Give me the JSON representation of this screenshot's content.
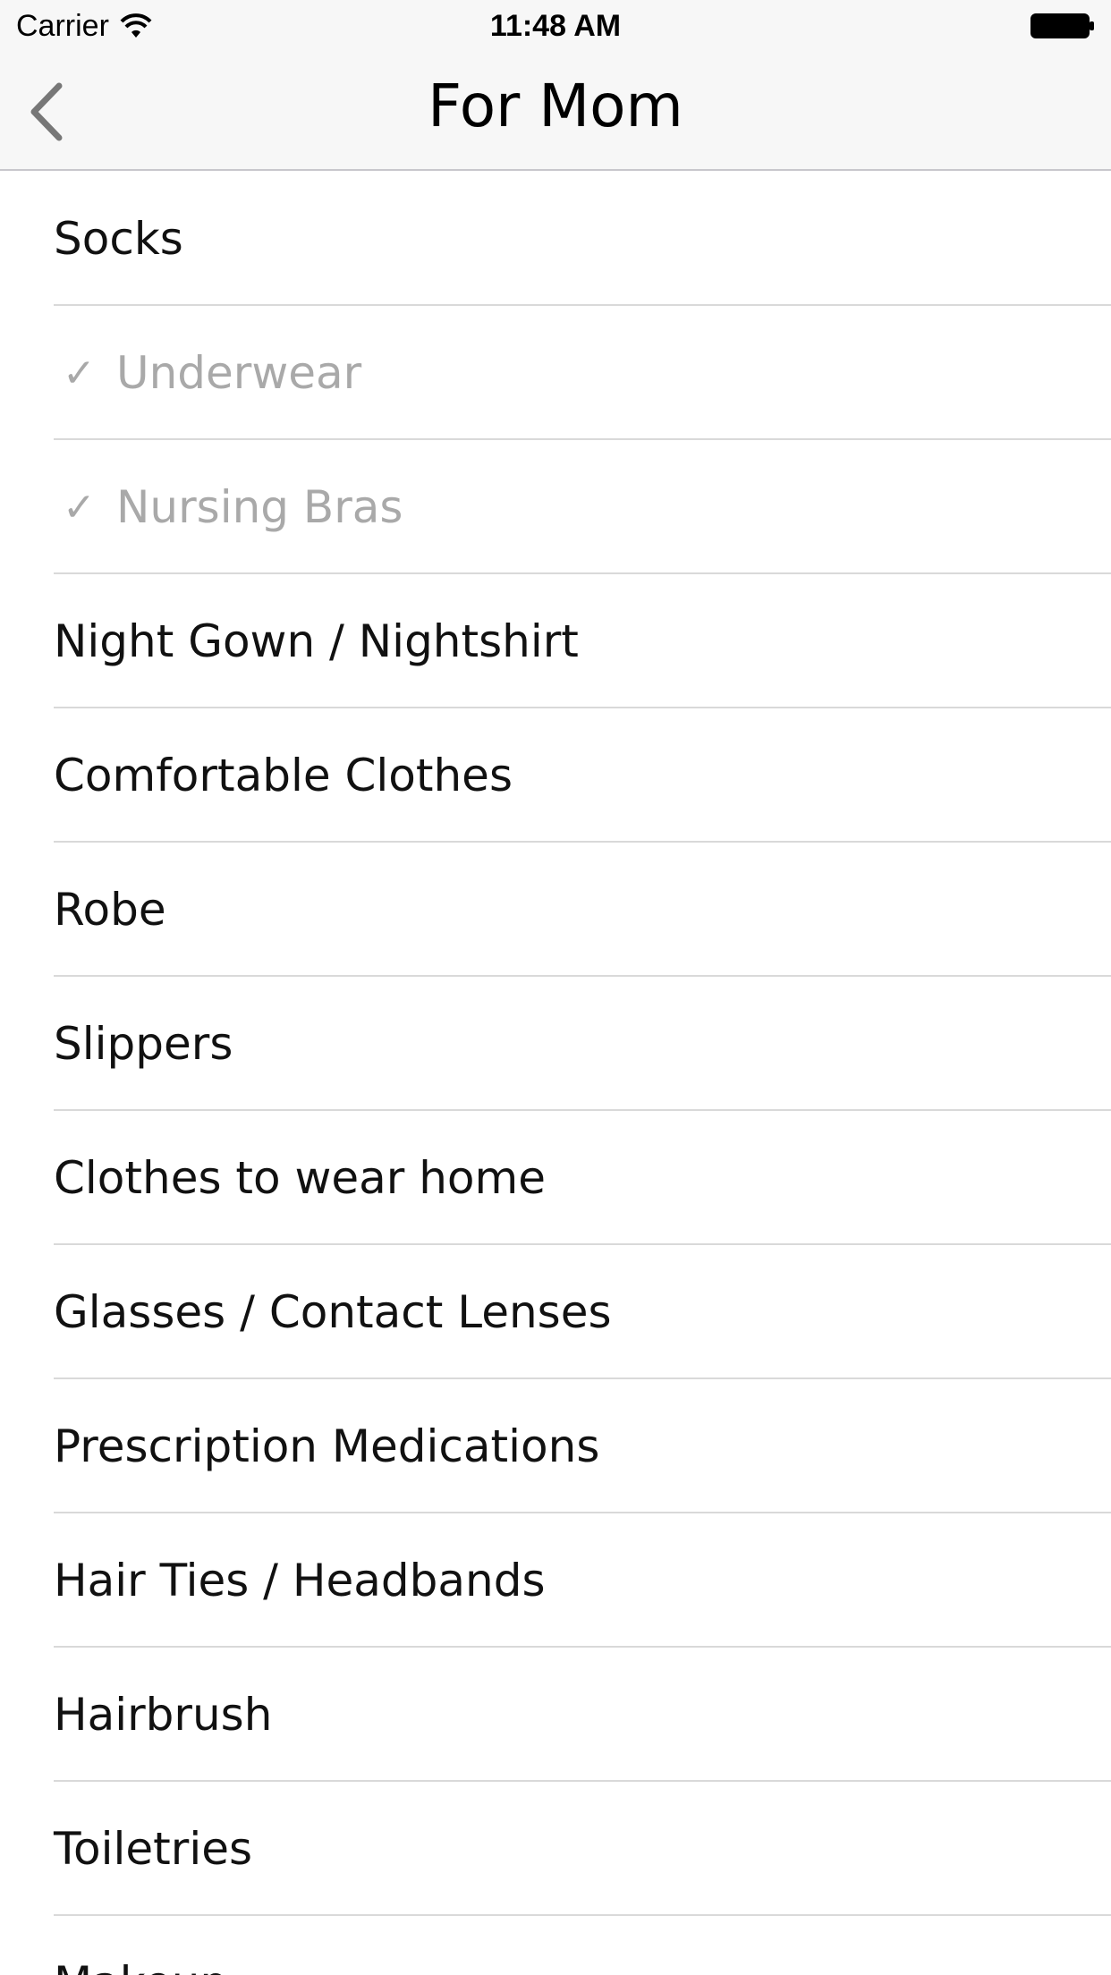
{
  "status_bar": {
    "carrier": "Carrier",
    "time": "11:48 AM"
  },
  "nav": {
    "title": "For Mom",
    "back_icon": "chevron-left-icon"
  },
  "colors": {
    "bar_background": "#f7f7f7",
    "checked_text": "#a9a9a9",
    "separator": "#d9d9d9"
  },
  "items": [
    {
      "label": "Socks",
      "checked": false
    },
    {
      "label": "Underwear",
      "checked": true
    },
    {
      "label": "Nursing Bras",
      "checked": true
    },
    {
      "label": "Night Gown / Nightshirt",
      "checked": false
    },
    {
      "label": "Comfortable Clothes",
      "checked": false
    },
    {
      "label": "Robe",
      "checked": false
    },
    {
      "label": "Slippers",
      "checked": false
    },
    {
      "label": "Clothes to wear home",
      "checked": false
    },
    {
      "label": "Glasses / Contact Lenses",
      "checked": false
    },
    {
      "label": "Prescription Medications",
      "checked": false
    },
    {
      "label": "Hair Ties / Headbands",
      "checked": false
    },
    {
      "label": "Hairbrush",
      "checked": false
    },
    {
      "label": "Toiletries",
      "checked": false
    },
    {
      "label": "Makeup",
      "checked": false
    }
  ],
  "check_glyph": "✓"
}
